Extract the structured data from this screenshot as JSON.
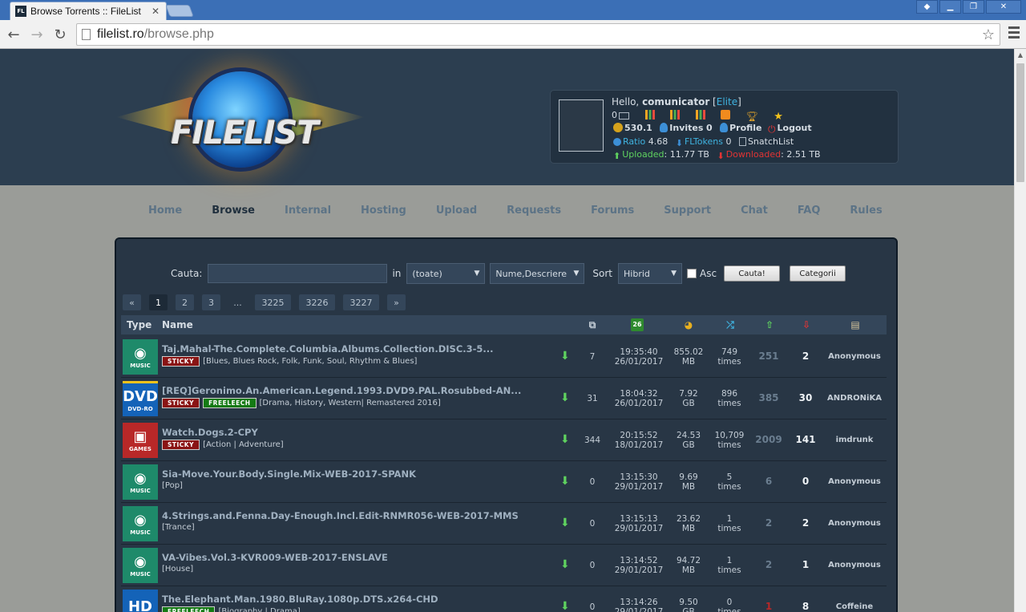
{
  "browser": {
    "tab_title": "Browse Torrents :: FileList",
    "tab_favicon": "FL",
    "url_host": "filelist.ro",
    "url_path": "/browse.php"
  },
  "user": {
    "hello": "Hello,",
    "name": "comunicator",
    "class": "Elite",
    "messages": "0",
    "bonus": "530.1",
    "invites_label": "Invites",
    "invites": "0",
    "profile": "Profile",
    "logout": "Logout",
    "ratio_label": "Ratio",
    "ratio": "4.68",
    "fltokens_label": "FLTokens",
    "fltokens": "0",
    "snatchlist": "SnatchList",
    "uploaded_label": "Uploaded",
    "uploaded": "11.77 TB",
    "downloaded_label": "Downloaded",
    "downloaded": "2.51 TB"
  },
  "logo_text": "FILELIST",
  "nav": [
    "Home",
    "Browse",
    "Internal",
    "Hosting",
    "Upload",
    "Requests",
    "Forums",
    "Support",
    "Chat",
    "FAQ",
    "Rules"
  ],
  "search": {
    "label": "Cauta:",
    "in_label": "in",
    "category": "(toate)",
    "field": "Nume,Descriere",
    "sort_label": "Sort",
    "sort": "Hibrid",
    "asc_label": "Asc",
    "search_button": "Cauta!",
    "categories_button": "Categorii"
  },
  "pager": [
    "«",
    "1",
    "2",
    "3",
    "...",
    "3225",
    "3226",
    "3227",
    "»"
  ],
  "table_header": {
    "type": "Type",
    "name": "Name"
  },
  "torrents": [
    {
      "cat": "MUSIC",
      "catclass": "music",
      "glyph": "◉",
      "name": "Taj.Mahal-The.Complete.Columbia.Albums.Collection.DISC.3-5...",
      "sticky": "STICKY",
      "free": "",
      "genres": "[Blues, Blues Rock, Folk, Funk, Soul, Rhythm & Blues]",
      "files": "7",
      "time": "19:35:40",
      "date": "26/01/2017",
      "size": "855.02",
      "unit": "MB",
      "snatched": "749",
      "times": "times",
      "seeders": "251",
      "leechers": "2",
      "uploader": "Anonymous"
    },
    {
      "cat": "DVD-RO",
      "catclass": "dvdro",
      "glyph": "DVD",
      "name": "[REQ]Geronimo.An.American.Legend.1993.DVD9.PAL.Rosubbed-AN...",
      "sticky": "STICKY",
      "free": "FREELEECH",
      "genres": "[Drama, History, Western| Remastered 2016]",
      "files": "31",
      "time": "18:04:32",
      "date": "26/01/2017",
      "size": "7.92",
      "unit": "GB",
      "snatched": "896",
      "times": "times",
      "seeders": "385",
      "leechers": "30",
      "uploader": "ANDRONiKA"
    },
    {
      "cat": "GAMES",
      "catclass": "games",
      "glyph": "▣",
      "name": "Watch.Dogs.2-CPY",
      "sticky": "STICKY",
      "free": "",
      "genres": "[Action | Adventure]",
      "files": "344",
      "time": "20:15:52",
      "date": "18/01/2017",
      "size": "24.53",
      "unit": "GB",
      "snatched": "10,709",
      "times": "times",
      "seeders": "2009",
      "leechers": "141",
      "uploader": "imdrunk"
    },
    {
      "cat": "MUSIC",
      "catclass": "music",
      "glyph": "◉",
      "name": "Sia-Move.Your.Body.Single.Mix-WEB-2017-SPANK",
      "sticky": "",
      "free": "",
      "genres": "[Pop]",
      "files": "0",
      "time": "13:15:30",
      "date": "29/01/2017",
      "size": "9.69",
      "unit": "MB",
      "snatched": "5",
      "times": "times",
      "seeders": "6",
      "leechers": "0",
      "uploader": "Anonymous"
    },
    {
      "cat": "MUSIC",
      "catclass": "music",
      "glyph": "◉",
      "name": "4.Strings.and.Fenna.Day-Enough.Incl.Edit-RNMR056-WEB-2017-MMS",
      "sticky": "",
      "free": "",
      "genres": "[Trance]",
      "files": "0",
      "time": "13:15:13",
      "date": "29/01/2017",
      "size": "23.62",
      "unit": "MB",
      "snatched": "1",
      "times": "times",
      "seeders": "2",
      "leechers": "2",
      "uploader": "Anonymous"
    },
    {
      "cat": "MUSIC",
      "catclass": "music",
      "glyph": "◉",
      "name": "VA-Vibes.Vol.3-KVR009-WEB-2017-ENSLAVE",
      "sticky": "",
      "free": "",
      "genres": "[House]",
      "files": "0",
      "time": "13:14:52",
      "date": "29/01/2017",
      "size": "94.72",
      "unit": "MB",
      "snatched": "1",
      "times": "times",
      "seeders": "2",
      "leechers": "1",
      "uploader": "Anonymous"
    },
    {
      "cat": "",
      "catclass": "hd",
      "glyph": "HD",
      "name": "The.Elephant.Man.1980.BluRay.1080p.DTS.x264-CHD",
      "sticky": "",
      "free": "FREELEECH",
      "genres": "[Biography | Drama]",
      "files": "0",
      "time": "13:14:26",
      "date": "29/01/2017",
      "size": "9.50",
      "unit": "GB",
      "snatched": "0",
      "times": "times",
      "seeders": "1",
      "leechers": "8",
      "uploader": "Coffeine"
    }
  ]
}
